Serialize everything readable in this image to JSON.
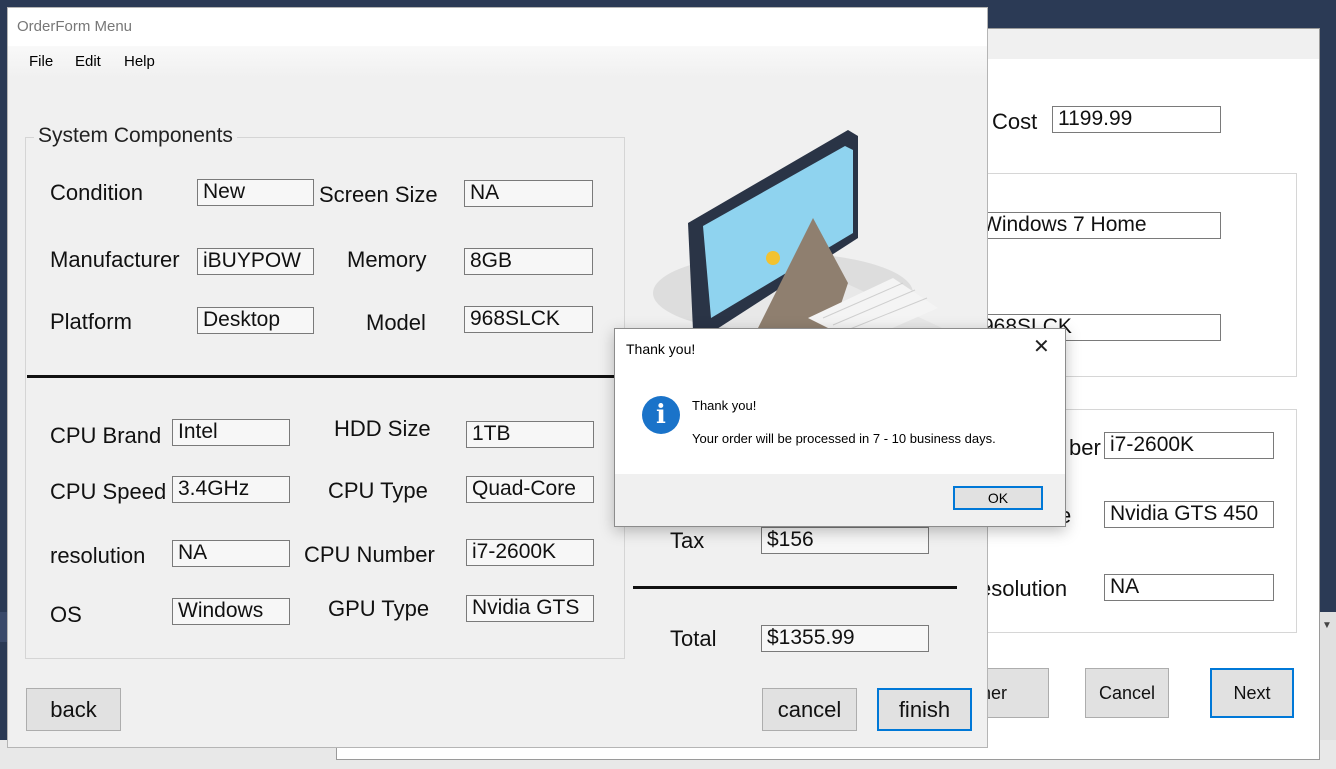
{
  "back_window": {
    "cost_label": "Cost",
    "cost_value": "1199.99",
    "os_value": "Windows 7 Home",
    "model_value": "968SLCK",
    "cpu_number_label": "ber",
    "cpu_number_value": "i7-2600K",
    "gpu_type_label": "e",
    "gpu_type_value": "Nvidia GTS 450",
    "resolution_label": "esolution",
    "resolution_value": "NA",
    "other_button": "her",
    "cancel_button": "Cancel",
    "next_button": "Next"
  },
  "window": {
    "title": "OrderForm Menu",
    "menu": [
      "File",
      "Edit",
      "Help"
    ]
  },
  "group": {
    "title": "System Components",
    "condition_label": "Condition",
    "condition_value": "New",
    "screen_size_label": "Screen Size",
    "screen_size_value": "NA",
    "manufacturer_label": "Manufacturer",
    "manufacturer_value": "iBUYPOW",
    "memory_label": "Memory",
    "memory_value": "8GB",
    "platform_label": "Platform",
    "platform_value": "Desktop",
    "model_label": "Model",
    "model_value": "968SLCK",
    "cpu_brand_label": "CPU Brand",
    "cpu_brand_value": "Intel",
    "hdd_size_label": "HDD Size",
    "hdd_size_value": "1TB",
    "cpu_speed_label": "CPU Speed",
    "cpu_speed_value": "3.4GHz",
    "cpu_type_label": "CPU Type",
    "cpu_type_value": "Quad-Core",
    "resolution_label": "resolution",
    "resolution_value": "NA",
    "cpu_number_label": "CPU Number",
    "cpu_number_value": "i7-2600K",
    "os_label": "OS",
    "os_value": "Windows",
    "gpu_type_label": "GPU Type",
    "gpu_type_value": "Nvidia GTS"
  },
  "totals": {
    "tax_label": "Tax",
    "tax_value": "$156",
    "total_label": "Total",
    "total_value": "$1355.99"
  },
  "buttons": {
    "back": "back",
    "cancel": "cancel",
    "finish": "finish"
  },
  "dialog": {
    "title": "Thank you!",
    "message_title": "Thank you!",
    "message_body": "Your order will be processed in 7 - 10 business days.",
    "ok": "OK",
    "icon": "info-icon"
  },
  "colors": {
    "accent": "#0078d7",
    "info_icon": "#1a73c9",
    "desktop": "#2b3a55"
  }
}
